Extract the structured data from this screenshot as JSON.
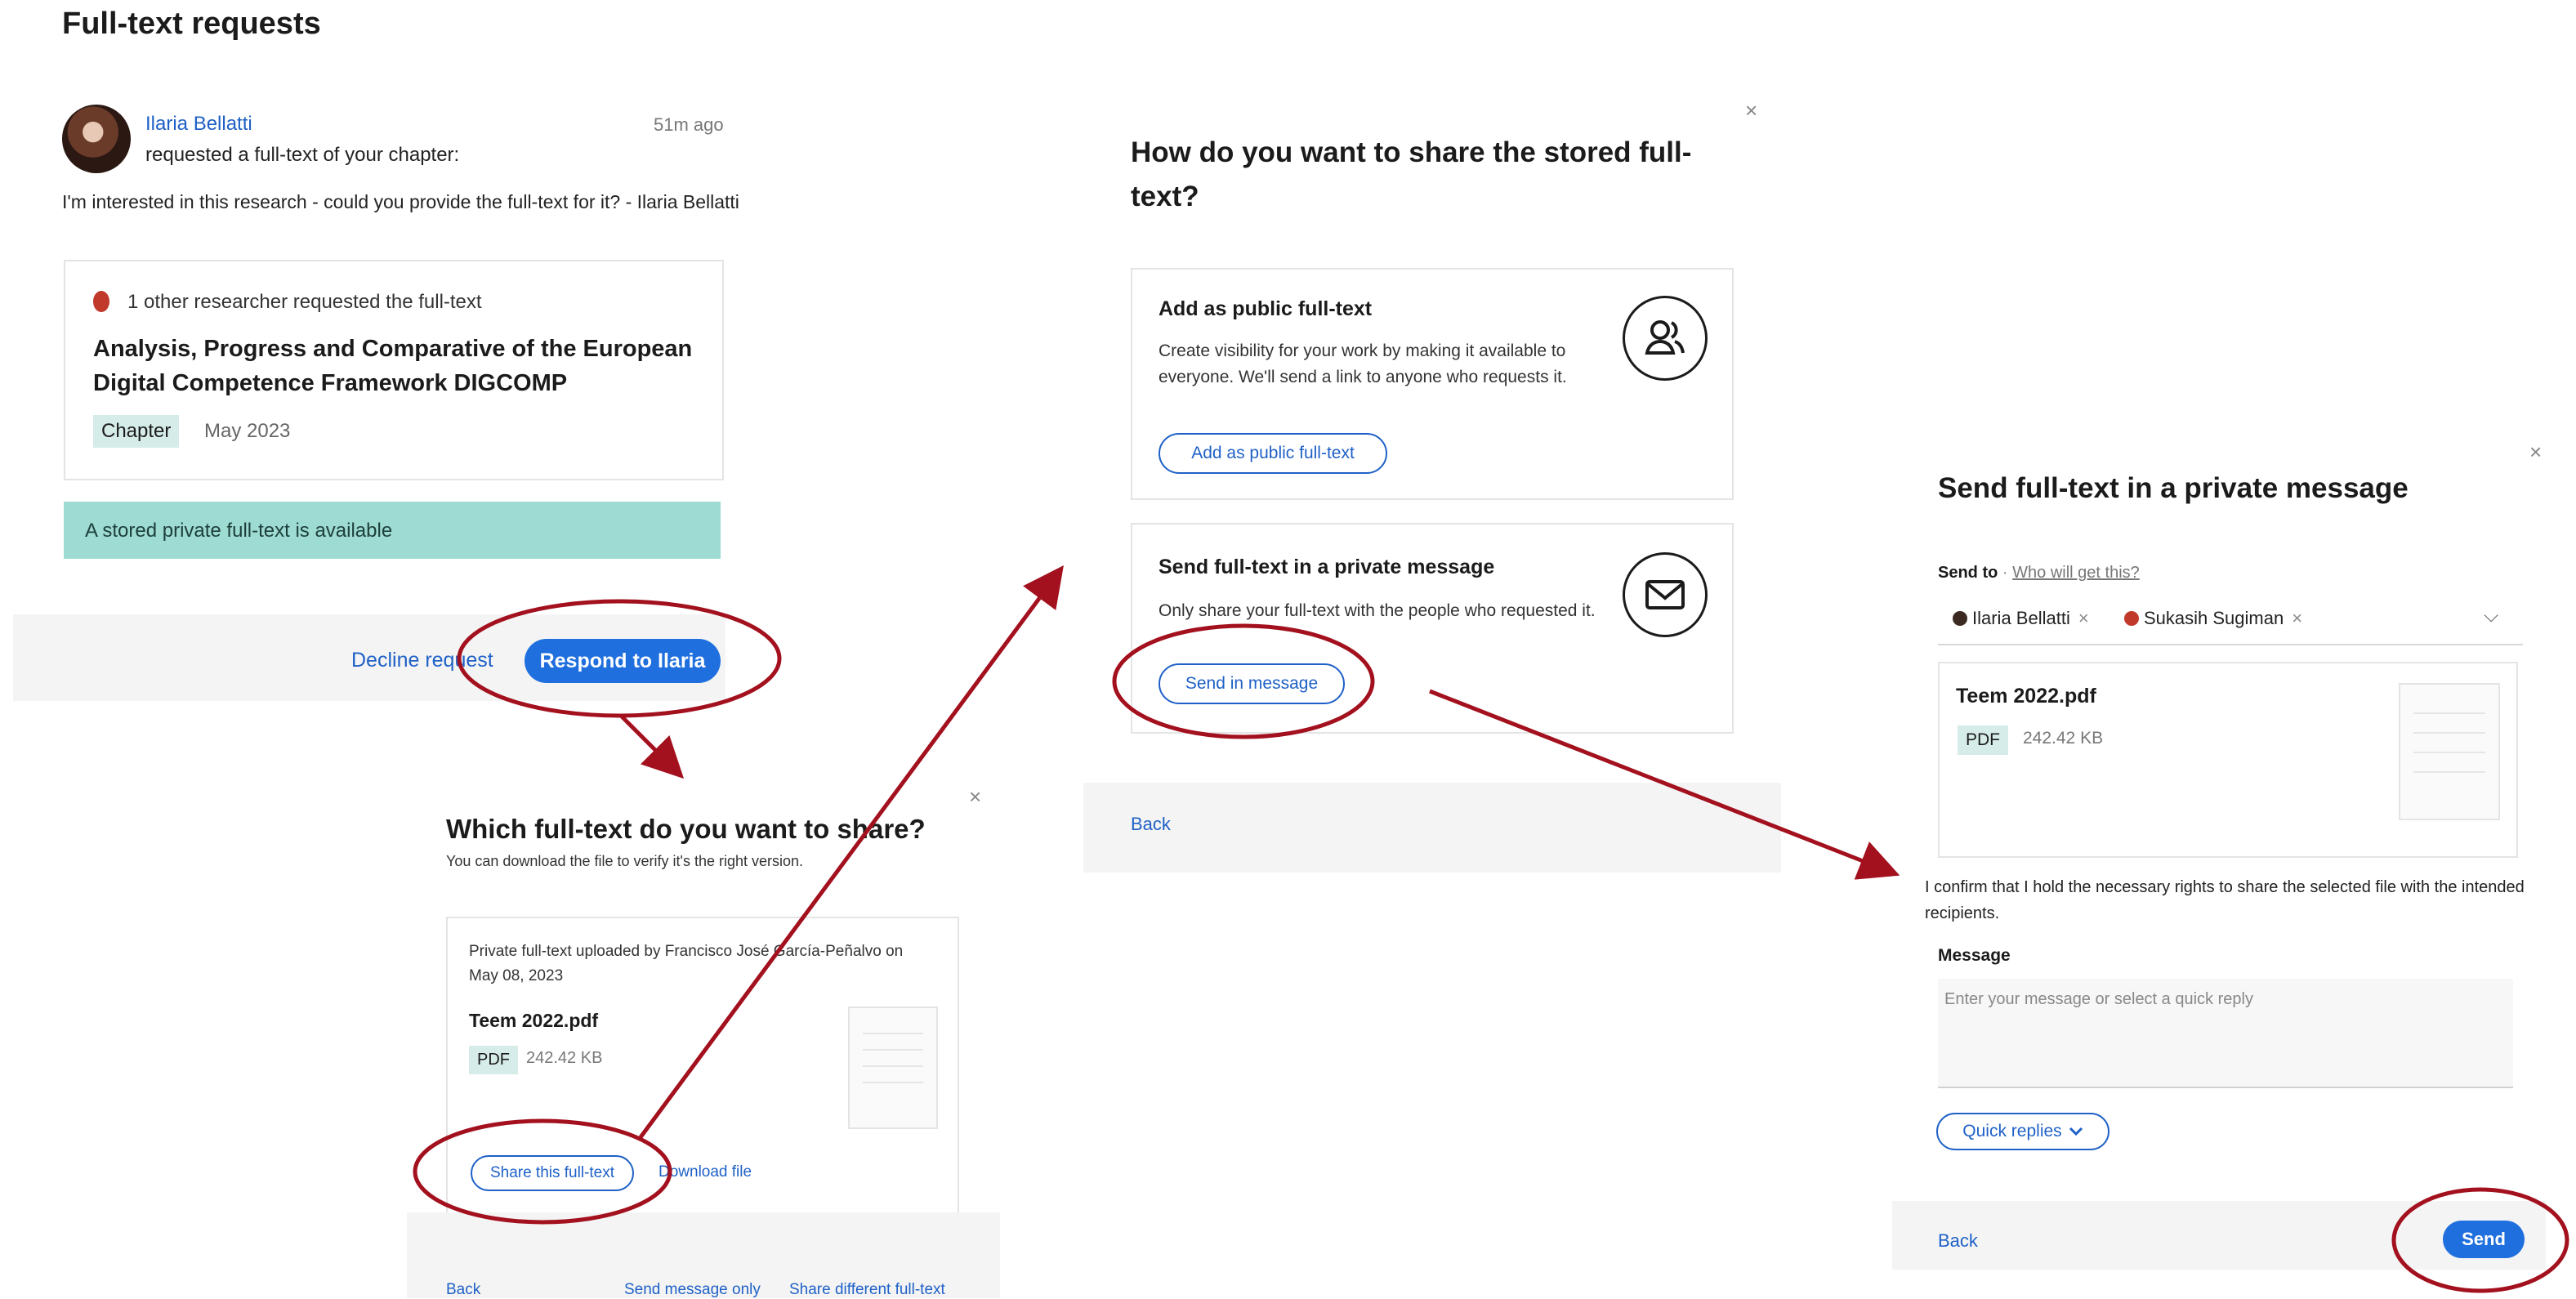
{
  "page_title": "Full-text requests",
  "request": {
    "requester": "Ilaria Bellatti",
    "time_ago": "51m ago",
    "action_text": "requested a full-text of your chapter:",
    "message": "I'm interested in this research - could you provide the full-text for it? - Ilaria Bellatti",
    "other_researchers": "1 other researcher requested the full-text",
    "publication_title": "Analysis, Progress and Comparative of the European Digital Competence Framework DIGCOMP",
    "publication_type": "Chapter",
    "publication_date": "May 2023",
    "banner": "A stored private full-text is available",
    "decline_label": "Decline request",
    "respond_label": "Respond to Ilaria"
  },
  "which_dialog": {
    "close": "×",
    "title": "Which full-text do you want to share?",
    "subtitle": "You can download the file to verify it's the right version.",
    "uploaded_by": "Private full-text uploaded by Francisco José García-Peñalvo on May 08, 2023",
    "file_name": "Teem 2022.pdf",
    "file_type": "PDF",
    "file_size": "242.42 KB",
    "share_label": "Share this full-text",
    "download_label": "Download file",
    "back_label": "Back",
    "send_message_only_label": "Send message only",
    "share_different_label": "Share different full-text"
  },
  "how_dialog": {
    "close": "×",
    "title": "How do you want to share the stored full-text?",
    "option_public": {
      "title": "Add as public full-text",
      "description": "Create visibility for your work by making it available to everyone. We'll send a link to anyone who requests it.",
      "button": "Add as public full-text",
      "icon": "people-icon"
    },
    "option_private": {
      "title": "Send full-text in a private message",
      "description": "Only share your full-text with the people who requested it.",
      "button": "Send in message",
      "icon": "envelope-icon"
    },
    "back_label": "Back"
  },
  "send_dialog": {
    "close": "×",
    "title": "Send full-text in a private message",
    "send_to_label": "Send to",
    "separator": "·",
    "who_label": "Who will get this?",
    "recipients": [
      "Ilaria Bellatti",
      "Sukasih Sugiman"
    ],
    "remove": "×",
    "dropdown": "⌵",
    "file_name": "Teem 2022.pdf",
    "file_type": "PDF",
    "file_size": "242.42 KB",
    "confirm_text": "I confirm that I hold the necessary rights to share the selected file with the intended recipients.",
    "message_label": "Message",
    "message_placeholder": "Enter your message or select a quick reply",
    "quick_replies_label": "Quick replies",
    "back_label": "Back",
    "send_label": "Send"
  },
  "colors": {
    "accent_blue": "#1f6fde",
    "annotation_red": "#a3101e",
    "banner_teal": "#9edbd3"
  }
}
